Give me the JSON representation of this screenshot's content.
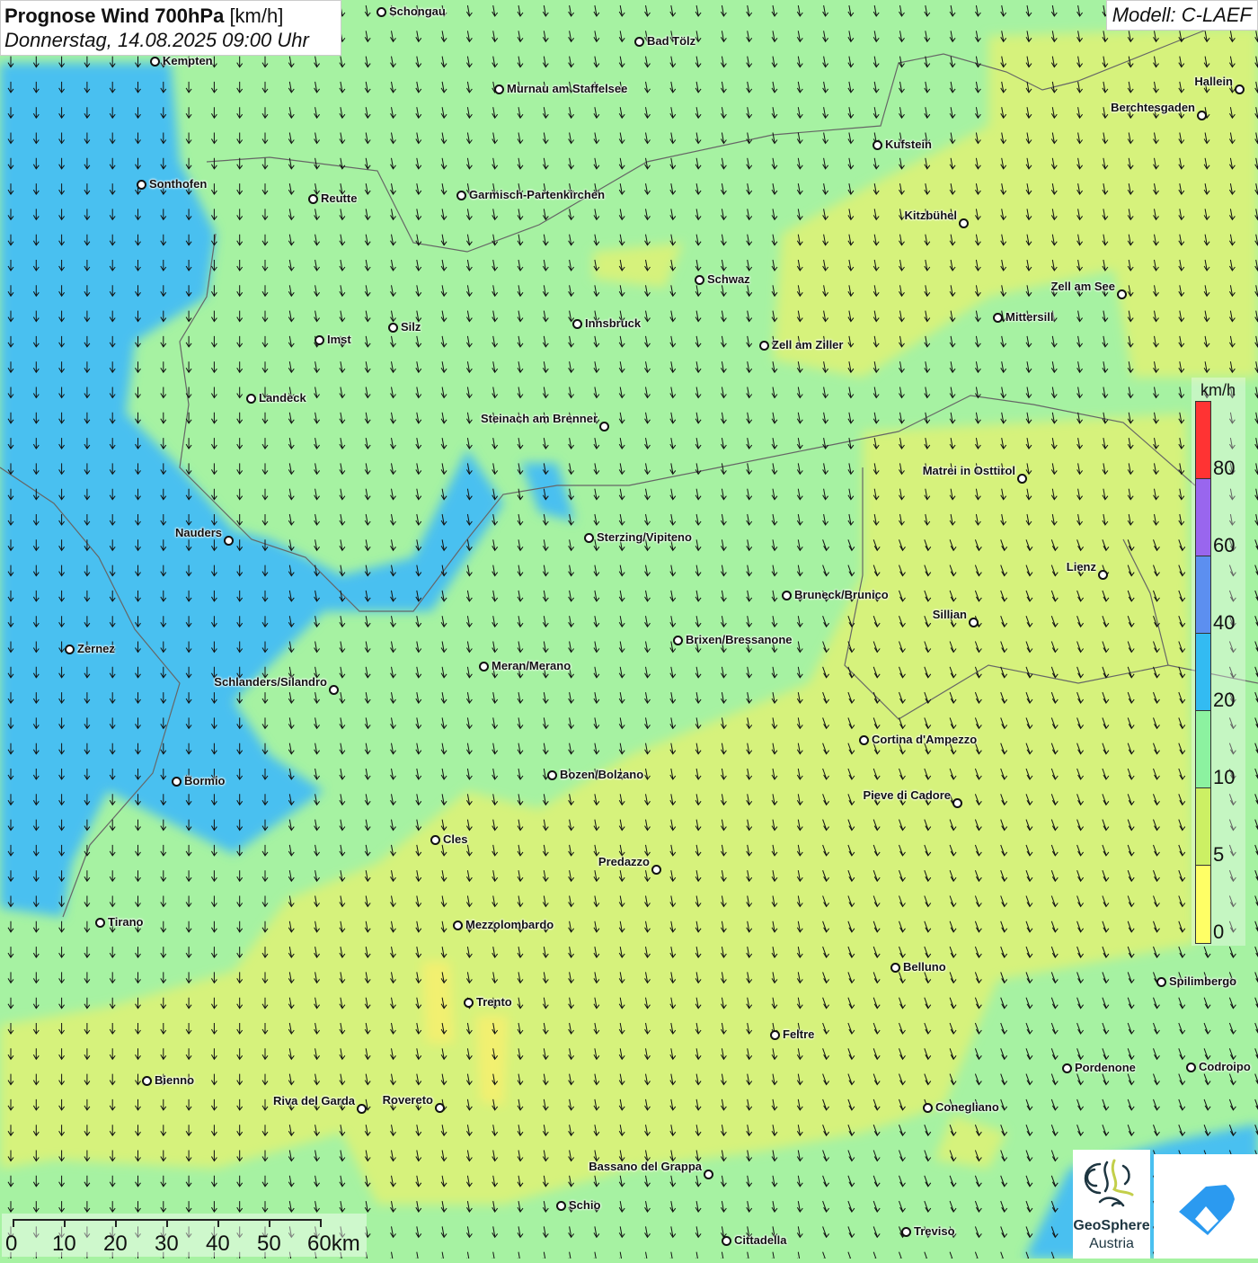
{
  "header": {
    "title_bold": "Prognose Wind 700hPa",
    "title_unit": "[km/h]",
    "datetime": "Donnerstag, 14.08.2025 09:00 Uhr",
    "model": "Modell: C-LAEF"
  },
  "legend": {
    "unit": "km/h",
    "labels": [
      "80",
      "60",
      "40",
      "20",
      "10",
      "5",
      "0"
    ],
    "colors": {
      "80+": "#ff3333",
      "60-80": "#9966ee",
      "40-60": "#5c8ff0",
      "20-40": "#33bbf2",
      "10-20": "#8cf2a0",
      "5-10": "#ccf064",
      "0-5": "#ffff66"
    }
  },
  "scale_bar": {
    "labels": [
      "0",
      "10",
      "20",
      "30",
      "40",
      "50",
      "60km"
    ]
  },
  "logos": {
    "geosphere_line1": "GeoSphere",
    "geosphere_line2": "Austria"
  },
  "cities": [
    "Schongau",
    "Bad Tölz",
    "Kempten",
    "Murnau am Staffelsee",
    "Hallein",
    "Berchtesgaden",
    "Kufstein",
    "Sonthofen",
    "Reutte",
    "Garmisch-Partenkirchen",
    "Kitzbühel",
    "Schwaz",
    "Zell am See",
    "Innsbruck",
    "Silz",
    "Imst",
    "Mittersill",
    "Zell am Ziller",
    "Landeck",
    "Steinach am Brenner",
    "Matrei in Osttirol",
    "Nauders",
    "Sterzing/Vipiteno",
    "Lienz",
    "Bruneck/Brunico",
    "Sillian",
    "Brixen/Bressanone",
    "Zernez",
    "Meran/Merano",
    "Schlanders/Silandro",
    "Cortina d'Ampezzo",
    "Bozen/Bolzano",
    "Bormio",
    "Pieve di Cadore",
    "Cles",
    "Predazzo",
    "Tirano",
    "Mezzolombardo",
    "Belluno",
    "Spilimbergo",
    "Trento",
    "Feltre",
    "Pordenone",
    "Codroipo",
    "Bienno",
    "Riva del Garda",
    "Rovereto",
    "Conegliano",
    "Bassano del Grappa",
    "Schio",
    "Treviso",
    "Cittadella"
  ]
}
